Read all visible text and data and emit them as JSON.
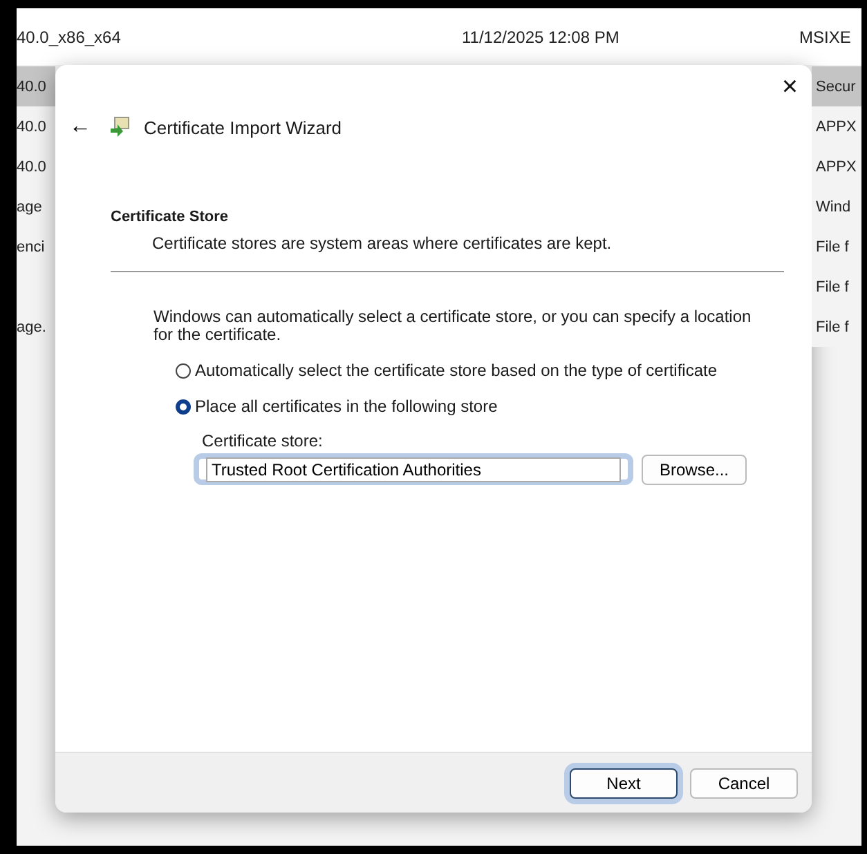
{
  "background_list": {
    "top_row": {
      "name": "40.0_x86_x64",
      "date": "11/12/2025 12:08 PM",
      "type": "MSIXE"
    },
    "left_rows": [
      {
        "text": "40.0",
        "selected": true
      },
      {
        "text": "40.0",
        "selected": false
      },
      {
        "text": "40.0",
        "selected": false
      },
      {
        "text": "age",
        "selected": false
      },
      {
        "text": "enci",
        "selected": false
      },
      {
        "text": "",
        "selected": false
      },
      {
        "text": "age.",
        "selected": false
      }
    ],
    "right_rows": [
      {
        "text": "Secur",
        "selected": true
      },
      {
        "text": "APPX",
        "selected": false
      },
      {
        "text": "APPX",
        "selected": false
      },
      {
        "text": "Wind",
        "selected": false
      },
      {
        "text": "File f",
        "selected": false
      },
      {
        "text": "File f",
        "selected": false
      },
      {
        "text": "File f",
        "selected": false
      }
    ]
  },
  "dialog": {
    "close": "×",
    "back": "←",
    "title": "Certificate Import Wizard",
    "section": {
      "heading": "Certificate Store",
      "description": "Certificate stores are system areas where certificates are kept."
    },
    "intro": "Windows can automatically select a certificate store, or you can specify a location for the certificate.",
    "options": [
      {
        "label": "Automatically select the certificate store based on the type of certificate",
        "selected": false
      },
      {
        "label": "Place all certificates in the following store",
        "selected": true
      }
    ],
    "store_label": "Certificate store:",
    "store_value": "Trusted Root Certification Authorities",
    "store_focused": true,
    "browse": "Browse...",
    "buttons": [
      {
        "label": "Next",
        "focused": true
      },
      {
        "label": "Cancel",
        "focused": false
      }
    ]
  }
}
